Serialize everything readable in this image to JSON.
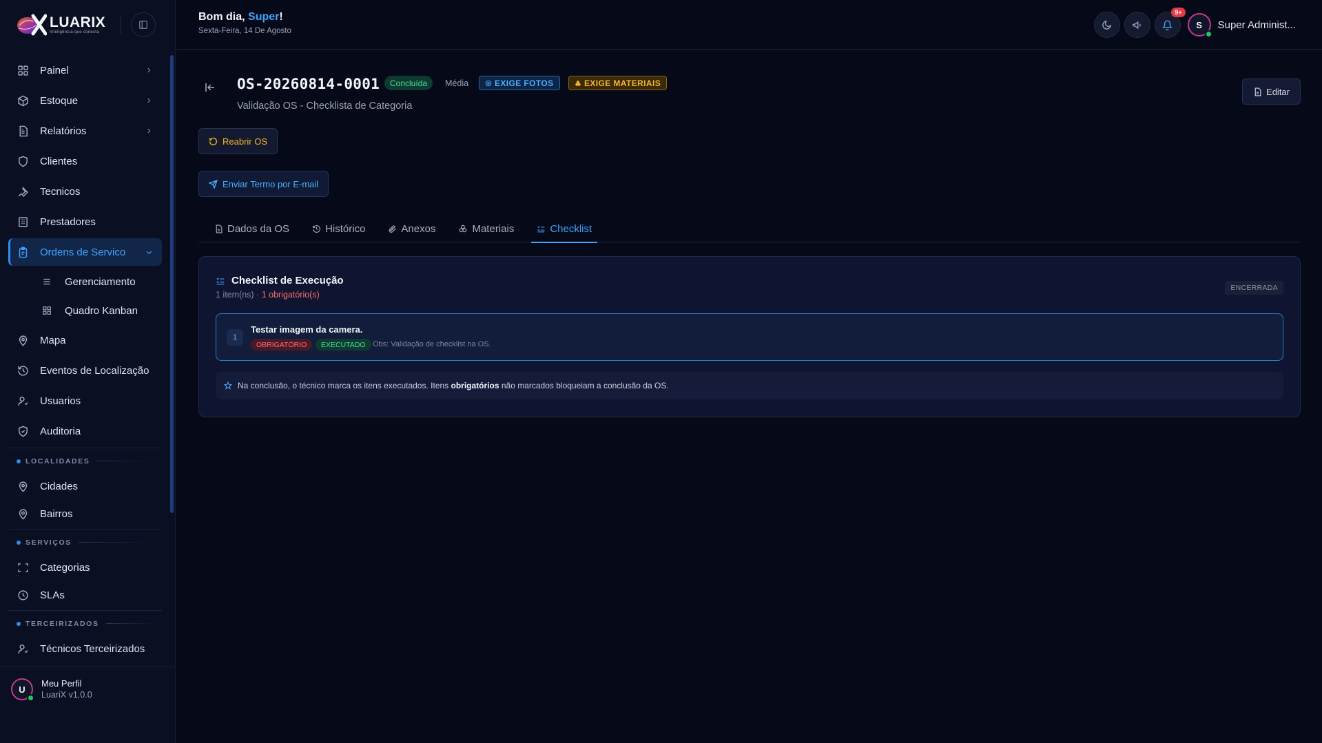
{
  "app": {
    "logo_name": "LUARIX",
    "logo_tagline": "Inteligência que conecta"
  },
  "sidebar": {
    "items": [
      {
        "label": "Painel",
        "icon": "grid-icon",
        "chevron": true
      },
      {
        "label": "Estoque",
        "icon": "package-icon",
        "chevron": true
      },
      {
        "label": "Relatórios",
        "icon": "file-text-icon",
        "chevron": true
      },
      {
        "label": "Clientes",
        "icon": "shield-icon"
      },
      {
        "label": "Tecnicos",
        "icon": "wrench-icon"
      },
      {
        "label": "Prestadores",
        "icon": "building-icon"
      },
      {
        "label": "Ordens de Servico",
        "icon": "clipboard-icon",
        "active": true,
        "expanded": true
      }
    ],
    "sub_items": [
      {
        "label": "Gerenciamento",
        "icon": "list-icon"
      },
      {
        "label": "Quadro Kanban",
        "icon": "grid-icon"
      }
    ],
    "items_after": [
      {
        "label": "Mapa",
        "icon": "map-pin-icon"
      },
      {
        "label": "Eventos de Localização",
        "icon": "history-icon"
      },
      {
        "label": "Usuarios",
        "icon": "user-icon"
      },
      {
        "label": "Auditoria",
        "icon": "shield-check-icon"
      }
    ],
    "sections": [
      {
        "title": "LOCALIDADES",
        "items": [
          {
            "label": "Cidades",
            "icon": "map-pin-icon"
          },
          {
            "label": "Bairros",
            "icon": "map-pin-icon"
          }
        ]
      },
      {
        "title": "SERVIÇOS",
        "items": [
          {
            "label": "Categorias",
            "icon": "scan-icon"
          },
          {
            "label": "SLAs",
            "icon": "clock-icon"
          }
        ]
      },
      {
        "title": "TERCEIRIZADOS",
        "items": [
          {
            "label": "Técnicos Terceirizados",
            "icon": "user-icon"
          }
        ]
      }
    ],
    "profile": {
      "initial": "U",
      "name": "Meu Perfil",
      "version": "LuariX v1.0.0"
    }
  },
  "header": {
    "greeting_prefix": "Bom dia, ",
    "greeting_name": "Super",
    "greeting_suffix": "!",
    "date": "Sexta-Feira, 14 De Agosto",
    "notifications_badge": "9+",
    "user_initial": "S",
    "user_name": "Super Administ..."
  },
  "os": {
    "id": "OS-20260814-0001",
    "status": "Concluída",
    "priority": "Média",
    "tag_photos": "EXIGE FOTOS",
    "tag_materials": "EXIGE MATERIAIS",
    "subtitle": "Validação OS - Checklista de Categoria",
    "edit_label": "Editar",
    "reopen_label": "Reabrir OS",
    "email_label": "Enviar Termo por E-mail"
  },
  "tabs": [
    {
      "label": "Dados da OS",
      "icon": "file-icon"
    },
    {
      "label": "Histórico",
      "icon": "history-icon"
    },
    {
      "label": "Anexos",
      "icon": "paperclip-icon"
    },
    {
      "label": "Materiais",
      "icon": "boxes-icon"
    },
    {
      "label": "Checklist",
      "icon": "checklist-icon",
      "active": true
    }
  ],
  "checklist": {
    "title": "Checklist de Execução",
    "count_text": "1 item(ns) · ",
    "required_text": "1 obrigatório(s)",
    "status": "ENCERRADA",
    "items": [
      {
        "number": "1",
        "title": "Testar imagem da camera.",
        "tag_required": "OBRIGATÓRIO",
        "tag_executed": "EXECUTADO",
        "obs": "Obs: Validação de checklist na OS."
      }
    ],
    "note_prefix": "Na conclusão, o técnico marca os itens executados. Itens ",
    "note_bold": "obrigatórios",
    "note_suffix": " não marcados bloqueiam a conclusão da OS."
  },
  "colors": {
    "accent": "#3da4ff",
    "success": "#4ade9c",
    "warning": "#f4b72c",
    "danger": "#ff6b6b",
    "background": "#060a18"
  }
}
